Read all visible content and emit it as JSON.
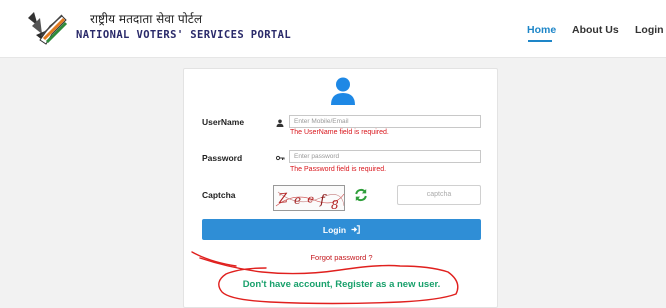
{
  "header": {
    "brand_hindi": "राष्ट्रीय मतदाता सेवा पोर्टल",
    "brand_english": "NATIONAL VOTERS' SERVICES PORTAL",
    "nav": [
      {
        "label": "Home",
        "active": true
      },
      {
        "label": "About Us",
        "active": false
      },
      {
        "label": "Login",
        "active": false
      }
    ]
  },
  "login_form": {
    "username": {
      "label": "UserName",
      "placeholder": "Enter Mobile/Email",
      "error": "The UserName field is required."
    },
    "password": {
      "label": "Password",
      "placeholder": "Enter password",
      "error": "The Password field is required."
    },
    "captcha": {
      "label": "Captcha",
      "image_text": "Z e e f 8",
      "placeholder": "captcha"
    },
    "login_button": "Login",
    "forgot_password": "Forgot password ?",
    "register_link": "Don't have account, Register as a new user."
  },
  "colors": {
    "accent": "#2f8ed6",
    "error": "#d9161c",
    "register": "#18a06b",
    "annotation": "#e0201e"
  },
  "icons": [
    "user-avatar-icon",
    "user-icon",
    "key-icon",
    "refresh-icon",
    "sign-in-icon"
  ]
}
